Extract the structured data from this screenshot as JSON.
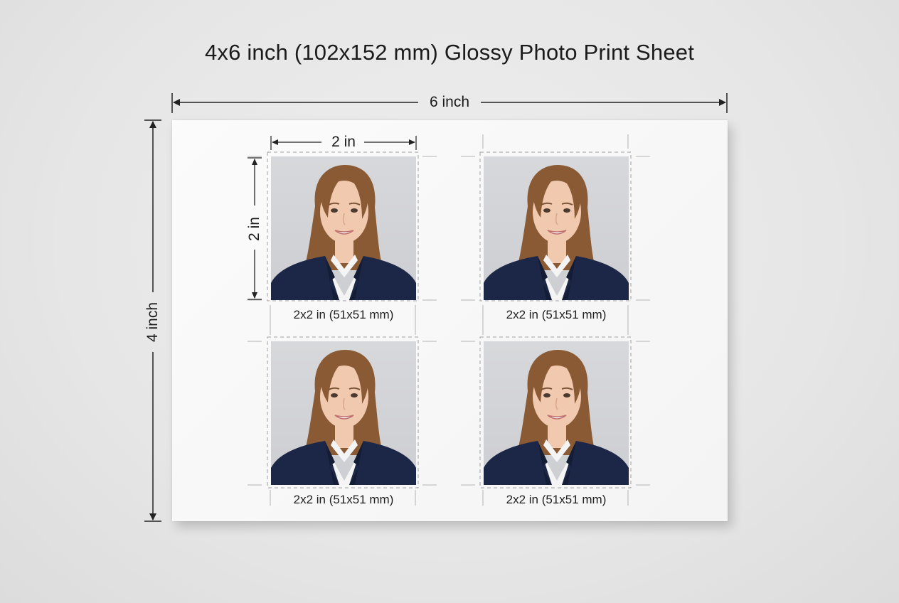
{
  "title": "4x6 inch (102x152 mm) Glossy Photo Print Sheet",
  "dimensions": {
    "sheet_width": "6 inch",
    "sheet_height": "4 inch",
    "photo_width": "2 in",
    "photo_height": "2 in"
  },
  "photos": [
    {
      "caption": "2x2 in (51x51 mm)"
    },
    {
      "caption": "2x2 in (51x51 mm)"
    },
    {
      "caption": "2x2 in (51x51 mm)"
    },
    {
      "caption": "2x2 in (51x51 mm)"
    }
  ],
  "colors": {
    "background": "#e8e8e8",
    "sheet": "#f8f8f8",
    "photo_backdrop": "#d3d4d7",
    "hair": "#8a5a34",
    "skin": "#f0c9ae",
    "jacket": "#1c2747",
    "shirt": "#f4f4f4",
    "guide_line": "#9a9a9a"
  }
}
